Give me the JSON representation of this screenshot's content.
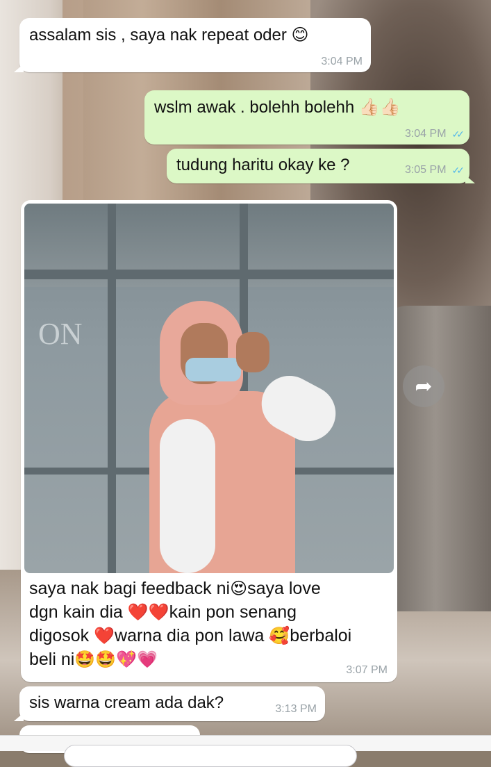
{
  "messages": [
    {
      "from": "contact",
      "text": "assalam sis , saya nak repeat oder",
      "emoji": "😊",
      "time": "3:04 PM"
    },
    {
      "from": "me",
      "text": "wslm awak . bolehh bolehh",
      "emoji": "👍🏻👍🏻",
      "time": "3:04 PM",
      "status": "read"
    },
    {
      "from": "me",
      "text": "tudung haritu okay ke ?",
      "time": "3:05 PM",
      "status": "read"
    },
    {
      "from": "contact",
      "type": "photo",
      "caption_parts": [
        "saya nak bagi feedback ni",
        "😍",
        "saya love",
        "dgn kain dia ",
        "❤️",
        "❤️",
        "kain pon senang",
        "digosok ",
        "❤️",
        "warna dia pon lawa ",
        "🥰",
        "berbaloi",
        "beli ni",
        "🤩",
        "🤩",
        "💖",
        "💗"
      ],
      "time": "3:07 PM"
    },
    {
      "from": "contact",
      "text": "sis warna cream ada dak?",
      "time": "3:13 PM"
    }
  ],
  "photo_signage": "ON",
  "icons": {
    "forward": "forward-arrow-icon",
    "read_ticks": "double-check-icon"
  },
  "colors": {
    "outgoing": "#dcf8c6",
    "incoming": "#ffffff",
    "read_tick": "#4fb6ec"
  }
}
